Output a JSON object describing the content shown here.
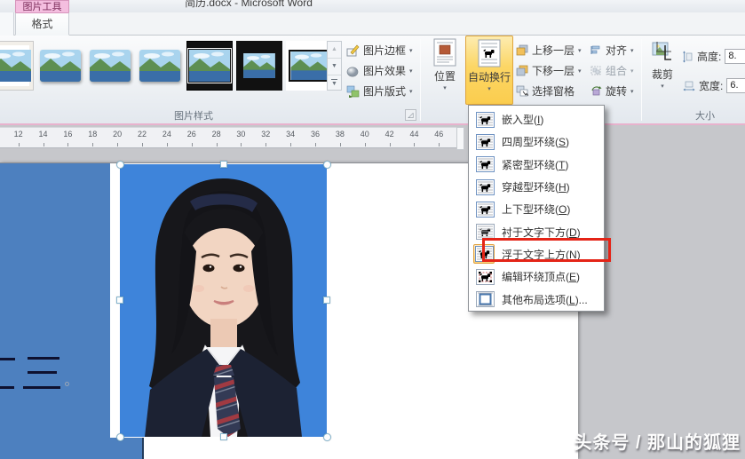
{
  "title_bar": {
    "title": "简历.docx - Microsoft Word"
  },
  "tabs": {
    "contextual_header": "图片工具",
    "format_tab": "格式"
  },
  "ribbon": {
    "picture_styles": {
      "group_label": "图片样式",
      "thumbnails": [
        {
          "style": "frame-white",
          "name": "simple-frame-white"
        },
        {
          "style": "plain",
          "name": "soft-edge-1"
        },
        {
          "style": "plain",
          "name": "soft-edge-2"
        },
        {
          "style": "plain",
          "name": "soft-edge-3"
        },
        {
          "style": "black-matte",
          "name": "metal-frame-black"
        },
        {
          "style": "black-frame",
          "name": "frame-black"
        },
        {
          "style": "thin-black",
          "name": "simple-frame-black"
        }
      ]
    },
    "style_buttons": {
      "border_label": "图片边框",
      "effects_label": "图片效果",
      "layout_label": "图片版式"
    },
    "arrange": {
      "position_label": "位置",
      "wrap_text_label": "自动换行",
      "bring_forward_label": "上移一层",
      "send_backward_label": "下移一层",
      "selection_pane_label": "选择窗格",
      "align_label": "对齐",
      "group_label_btn": "组合",
      "rotate_label": "旋转"
    },
    "size": {
      "group_label": "大小",
      "crop_label": "裁剪",
      "height_label": "高度:",
      "height_value": "8.",
      "width_label": "宽度:",
      "width_value": "6."
    }
  },
  "ruler": {
    "numbers": [
      "12",
      "14",
      "16",
      "18",
      "20",
      "22",
      "24",
      "26",
      "28",
      "30",
      "32",
      "34",
      "36",
      "38",
      "40",
      "42",
      "44",
      "46"
    ]
  },
  "wrap_menu": {
    "items": [
      {
        "pre": "嵌入型(",
        "key": "I",
        "post": ")",
        "icon": "wrap-inline",
        "selected": false,
        "boxed": false
      },
      {
        "pre": "四周型环绕(",
        "key": "S",
        "post": ")",
        "icon": "wrap-square",
        "selected": false,
        "boxed": false
      },
      {
        "pre": "紧密型环绕(",
        "key": "T",
        "post": ")",
        "icon": "wrap-tight",
        "selected": false,
        "boxed": false
      },
      {
        "pre": "穿越型环绕(",
        "key": "H",
        "post": ")",
        "icon": "wrap-through",
        "selected": false,
        "boxed": false
      },
      {
        "pre": "上下型环绕(",
        "key": "O",
        "post": ")",
        "icon": "wrap-topbottom",
        "selected": false,
        "boxed": false
      },
      {
        "pre": "衬于文字下方(",
        "key": "D",
        "post": ")",
        "icon": "wrap-behind",
        "selected": false,
        "boxed": false
      },
      {
        "pre": "浮于文字上方(",
        "key": "N",
        "post": ")",
        "icon": "wrap-front",
        "selected": true,
        "boxed": true
      },
      {
        "pre": "编辑环绕顶点(",
        "key": "E",
        "post": ")",
        "icon": "edit-points",
        "selected": false,
        "boxed": false
      },
      {
        "pre": "其他布局选项(",
        "key": "L",
        "post": ")...",
        "icon": "more-options",
        "selected": false,
        "boxed": false
      }
    ]
  },
  "watermark": {
    "text": "头条号 / 那山的狐狸"
  },
  "colors": {
    "photo_background": "#3e84da",
    "sidebar_blue": "#4d80bf",
    "wrap_button_orange": "#fcd665",
    "annotation_red": "#e42417",
    "contextual_tab_pink": "#f4bedf"
  }
}
